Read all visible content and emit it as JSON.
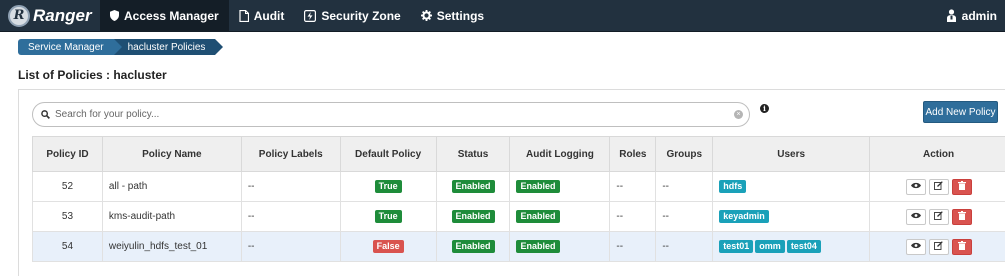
{
  "navbar": {
    "brand": "Ranger",
    "items": [
      {
        "label": "Access Manager",
        "icon": "shield-icon",
        "active": true
      },
      {
        "label": "Audit",
        "icon": "file-icon",
        "active": false
      },
      {
        "label": "Security Zone",
        "icon": "zone-icon",
        "active": false
      },
      {
        "label": "Settings",
        "icon": "gear-icon",
        "active": false
      }
    ],
    "user": "admin"
  },
  "breadcrumb": [
    "Service Manager",
    "hacluster Policies"
  ],
  "page_title": "List of Policies : hacluster",
  "search": {
    "placeholder": "Search for your policy...",
    "value": ""
  },
  "add_button": "Add New Policy",
  "table": {
    "headers": [
      "Policy ID",
      "Policy Name",
      "Policy Labels",
      "Default Policy",
      "Status",
      "Audit Logging",
      "Roles",
      "Groups",
      "Users",
      "Action"
    ],
    "rows": [
      {
        "id": "52",
        "name": "all - path",
        "labels": "--",
        "default": "True",
        "status": "Enabled",
        "audit": "Enabled",
        "roles": "--",
        "groups": "--",
        "users": [
          "hdfs"
        ]
      },
      {
        "id": "53",
        "name": "kms-audit-path",
        "labels": "--",
        "default": "True",
        "status": "Enabled",
        "audit": "Enabled",
        "roles": "--",
        "groups": "--",
        "users": [
          "keyadmin"
        ]
      },
      {
        "id": "54",
        "name": "weiyulin_hdfs_test_01",
        "labels": "--",
        "default": "False",
        "status": "Enabled",
        "audit": "Enabled",
        "roles": "--",
        "groups": "--",
        "users": [
          "test01",
          "omm",
          "test04"
        ]
      }
    ]
  },
  "colors": {
    "navbar": "#22313f",
    "accent": "#2f6e9b",
    "success": "#1e8c3a",
    "danger": "#d9534f",
    "user_tag": "#1aa1b9"
  }
}
